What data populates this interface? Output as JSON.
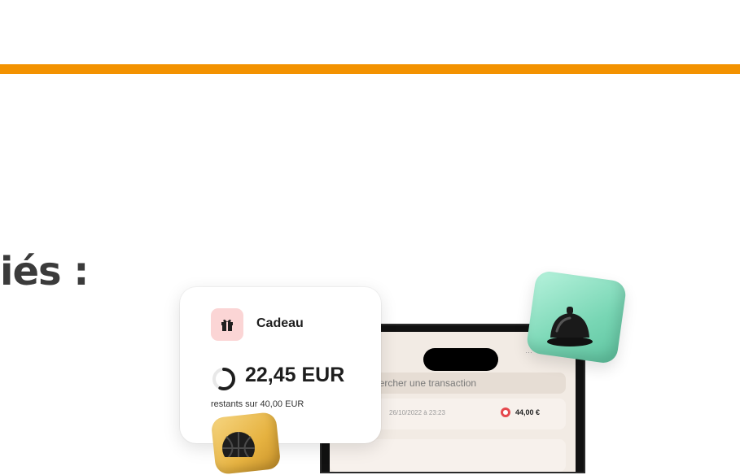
{
  "headline": "iés :",
  "phone": {
    "search_placeholder": "hercher une transaction",
    "transaction": {
      "date": "26/10/2022 à 23:23",
      "amount": "44,00 €"
    },
    "status": "···"
  },
  "card": {
    "label": "Cadeau",
    "amount": "22,45 EUR",
    "subtitle": "restants sur 40,00 EUR",
    "remaining_fraction": 0.56
  },
  "icons": {
    "gift": "gift-icon",
    "bell": "service-bell-icon",
    "ball": "basketball-icon",
    "progress": "progress-ring-icon"
  },
  "colors": {
    "accent": "#f39200",
    "gift_badge": "#fbd5d5",
    "tile_green": "#78d6b4",
    "tile_gold": "#e6b240",
    "debit_red": "#e5484d"
  }
}
